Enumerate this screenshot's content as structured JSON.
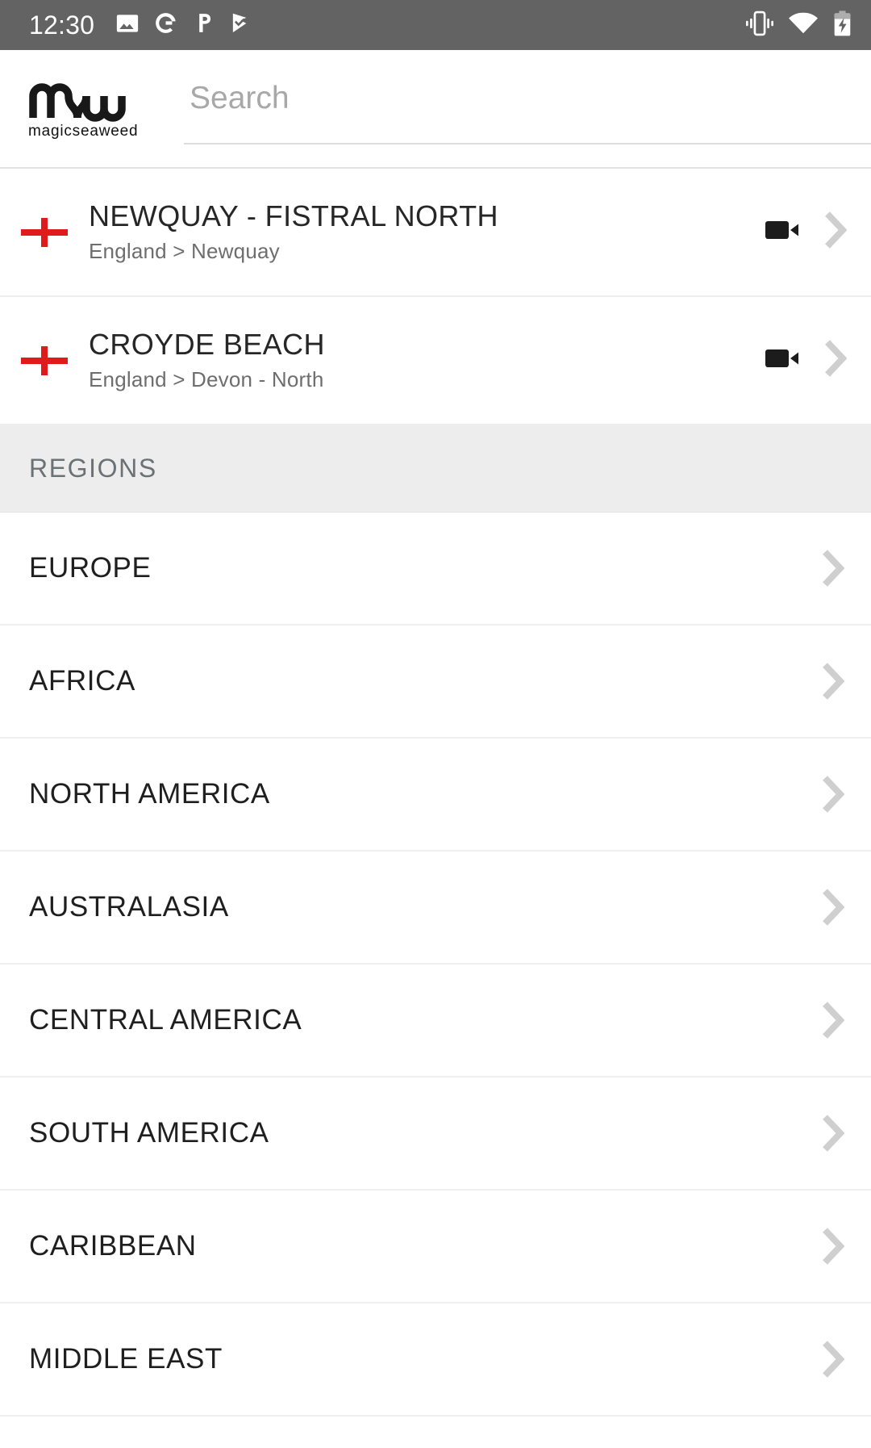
{
  "status_bar": {
    "clock": "12:30",
    "left_icons": [
      "image-icon",
      "google-icon",
      "pinterest-icon",
      "checkmark-flag-icon"
    ],
    "right_icons": [
      "vibrate-icon",
      "wifi-icon",
      "battery-charging-icon"
    ],
    "background_color": "#636363",
    "foreground_color": "#ffffff"
  },
  "header": {
    "logo_mark": "msw-logo",
    "logo_wordmark": "magicseaweed",
    "search": {
      "placeholder": "Search",
      "value": ""
    }
  },
  "favorites": [
    {
      "flag": "england-flag-icon",
      "name": "NEWQUAY - FISTRAL NORTH",
      "breadcrumb": "England > Newquay",
      "has_webcam": true,
      "webcam_icon": "video-camera-icon",
      "chevron": "chevron-right-icon"
    },
    {
      "flag": "england-flag-icon",
      "name": "CROYDE BEACH",
      "breadcrumb": "England > Devon - North",
      "has_webcam": true,
      "webcam_icon": "video-camera-icon",
      "chevron": "chevron-right-icon"
    }
  ],
  "regions_section": {
    "title": "REGIONS",
    "items": [
      {
        "label": "EUROPE",
        "chevron": "chevron-right-icon"
      },
      {
        "label": "AFRICA",
        "chevron": "chevron-right-icon"
      },
      {
        "label": "NORTH AMERICA",
        "chevron": "chevron-right-icon"
      },
      {
        "label": "AUSTRALASIA",
        "chevron": "chevron-right-icon"
      },
      {
        "label": "CENTRAL AMERICA",
        "chevron": "chevron-right-icon"
      },
      {
        "label": "SOUTH AMERICA",
        "chevron": "chevron-right-icon"
      },
      {
        "label": "CARIBBEAN",
        "chevron": "chevron-right-icon"
      },
      {
        "label": "MIDDLE EAST",
        "chevron": "chevron-right-icon"
      }
    ]
  },
  "colors": {
    "status_bar": "#636363",
    "section_header_bg": "#ededed",
    "section_header_text": "#6b7275",
    "flag_red": "#e01b1b",
    "chevron_gray": "#cfcfcf",
    "placeholder_gray": "#a8a8a8",
    "divider": "#ededed"
  }
}
